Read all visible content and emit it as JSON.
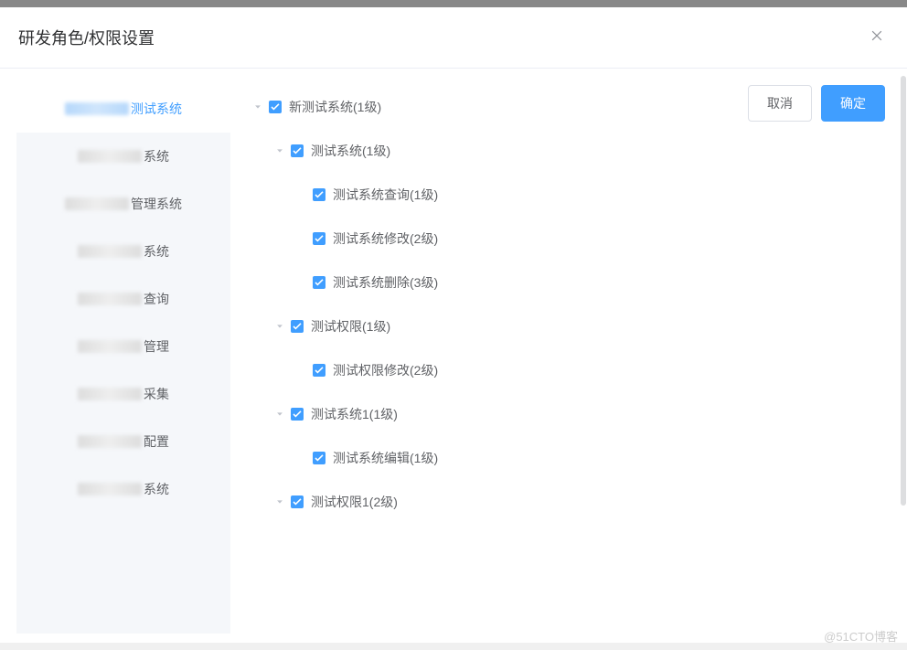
{
  "dialog": {
    "title": "研发角色/权限设置"
  },
  "sidebar": {
    "items": [
      {
        "suffix": "测试系统",
        "active": true
      },
      {
        "suffix": "系统",
        "active": false
      },
      {
        "suffix": "管理系统",
        "active": false
      },
      {
        "suffix": "系统",
        "active": false
      },
      {
        "suffix": "查询",
        "active": false
      },
      {
        "suffix": "管理",
        "active": false
      },
      {
        "suffix": "采集",
        "active": false
      },
      {
        "suffix": "配置",
        "active": false
      },
      {
        "suffix": "系统",
        "active": false
      }
    ]
  },
  "tree": [
    {
      "indent": 0,
      "expand": "expanded",
      "checked": true,
      "label": "新测试系统(1级)"
    },
    {
      "indent": 1,
      "expand": "expanded",
      "checked": true,
      "label": "测试系统(1级)"
    },
    {
      "indent": 2,
      "expand": "hidden",
      "checked": true,
      "label": "测试系统查询(1级)"
    },
    {
      "indent": 2,
      "expand": "hidden",
      "checked": true,
      "label": "测试系统修改(2级)"
    },
    {
      "indent": 2,
      "expand": "hidden",
      "checked": true,
      "label": "测试系统删除(3级)"
    },
    {
      "indent": 1,
      "expand": "expanded",
      "checked": true,
      "label": "测试权限(1级)"
    },
    {
      "indent": 2,
      "expand": "hidden",
      "checked": true,
      "label": "测试权限修改(2级)"
    },
    {
      "indent": 1,
      "expand": "expanded",
      "checked": true,
      "label": "测试系统1(1级)"
    },
    {
      "indent": 2,
      "expand": "hidden",
      "checked": true,
      "label": "测试系统编辑(1级)"
    },
    {
      "indent": 1,
      "expand": "expanded",
      "checked": true,
      "label": "测试权限1(2级)"
    }
  ],
  "actions": {
    "cancel": "取消",
    "confirm": "确定"
  },
  "watermark": "@51CTO博客"
}
